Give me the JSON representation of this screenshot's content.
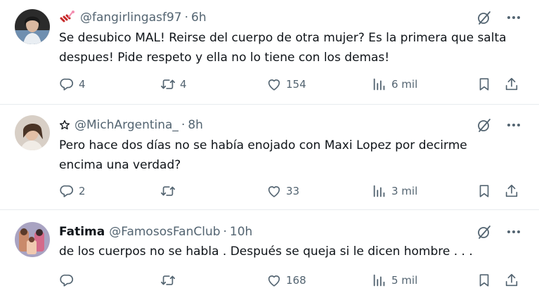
{
  "tweets": [
    {
      "name": "",
      "handle": "@fangirlingasf97",
      "dot": "·",
      "time": "6h",
      "text": "Se desubico MAL! Reirse del cuerpo de otra mujer? Es la primera que salta despues! Pide respeto y ella no lo tiene con los demas!",
      "replies": "4",
      "retweets": "4",
      "likes": "154",
      "views": "6 mil"
    },
    {
      "name": "",
      "handle": "@MichArgentina_",
      "dot": "·",
      "time": "8h",
      "text": "Pero hace dos días no se había enojado con Maxi Lopez por decirme encima una verdad?",
      "replies": "2",
      "retweets": "",
      "likes": "33",
      "views": "3 mil"
    },
    {
      "name": "Fatima",
      "handle": "@FamososFanClub",
      "dot": "·",
      "time": "10h",
      "text": "de los cuerpos no se habla . Después se queja si le dicen hombre . . .",
      "replies": "",
      "retweets": "",
      "likes": "168",
      "views": "5 mil"
    }
  ],
  "icons": {
    "reply": "reply-icon",
    "retweet": "retweet-icon",
    "like": "like-icon",
    "views": "views-icon",
    "bookmark": "bookmark-icon",
    "share": "share-icon",
    "grok": "grok-icon",
    "more": "more-icon"
  },
  "colors": {
    "text": "#0f1419",
    "secondary": "#536471",
    "divider": "#e7ebee"
  }
}
